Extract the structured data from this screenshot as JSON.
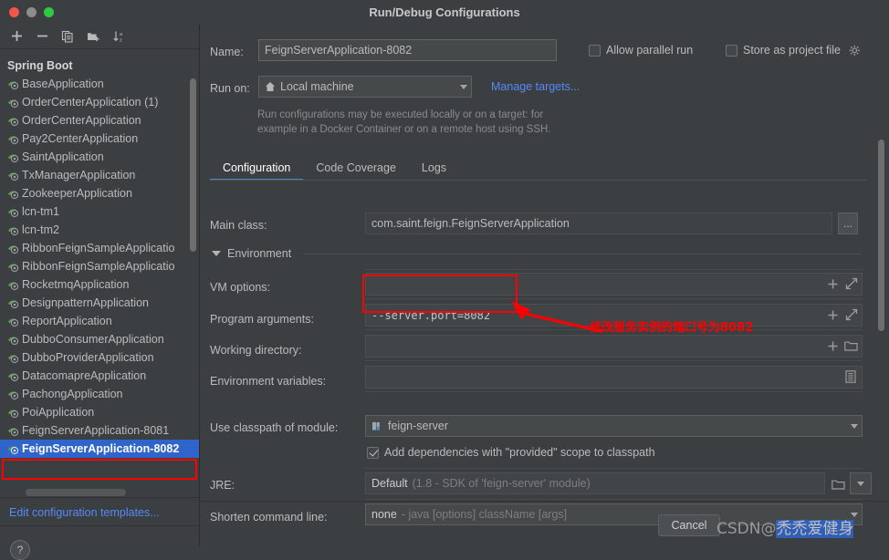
{
  "window": {
    "title": "Run/Debug Configurations",
    "traffic_lights": [
      "close",
      "minimize",
      "zoom"
    ]
  },
  "toolbar": {
    "buttons": [
      {
        "name": "add",
        "icon": "plus-icon"
      },
      {
        "name": "remove",
        "icon": "minus-icon"
      },
      {
        "name": "copy",
        "icon": "copy-icon"
      },
      {
        "name": "save-configuration",
        "icon": "folder-add-icon"
      },
      {
        "name": "sort-alphabetically",
        "icon": "sort-az-icon"
      }
    ]
  },
  "sidebar": {
    "group_header": "Spring Boot",
    "items": [
      {
        "label": "BaseApplication",
        "selected": false
      },
      {
        "label": "OrderCenterApplication (1)",
        "selected": false
      },
      {
        "label": "OrderCenterApplication",
        "selected": false
      },
      {
        "label": "Pay2CenterApplication",
        "selected": false
      },
      {
        "label": "SaintApplication",
        "selected": false
      },
      {
        "label": "TxManagerApplication",
        "selected": false
      },
      {
        "label": "ZookeeperApplication",
        "selected": false
      },
      {
        "label": "lcn-tm1",
        "selected": false
      },
      {
        "label": "lcn-tm2",
        "selected": false
      },
      {
        "label": "RibbonFeignSampleApplicatio",
        "selected": false
      },
      {
        "label": "RibbonFeignSampleApplicatio",
        "selected": false
      },
      {
        "label": "RocketmqApplication",
        "selected": false
      },
      {
        "label": "DesignpatternApplication",
        "selected": false
      },
      {
        "label": "ReportApplication",
        "selected": false
      },
      {
        "label": "DubboConsumerApplication",
        "selected": false
      },
      {
        "label": "DubboProviderApplication",
        "selected": false
      },
      {
        "label": "DatacomapreApplication",
        "selected": false
      },
      {
        "label": "PachongApplication",
        "selected": false
      },
      {
        "label": "PoiApplication",
        "selected": false
      },
      {
        "label": "FeignServerApplication-8081",
        "selected": false
      },
      {
        "label": "FeignServerApplication-8082",
        "selected": true
      }
    ],
    "edit_templates_link": "Edit configuration templates...",
    "help_label": "?"
  },
  "form": {
    "name_label": "Name:",
    "name_value": "FeignServerApplication-8082",
    "allow_parallel_run": {
      "label": "Allow parallel run",
      "checked": false
    },
    "store_as_project_file": {
      "label": "Store as project file",
      "checked": false
    },
    "run_on_label": "Run on:",
    "run_on_value": "Local machine",
    "manage_targets_link": "Manage targets...",
    "hint_line1": "Run configurations may be executed locally or on a target: for",
    "hint_line2": "example in a Docker Container or on a remote host using SSH.",
    "tabs": [
      {
        "label": "Configuration",
        "active": true
      },
      {
        "label": "Code Coverage",
        "active": false
      },
      {
        "label": "Logs",
        "active": false
      }
    ],
    "main_class_label": "Main class:",
    "main_class_value": "com.saint.feign.FeignServerApplication",
    "main_class_browse": "...",
    "environment_section": "Environment",
    "vm_options_label": "VM options:",
    "vm_options_value": "",
    "program_arguments_label": "Program arguments:",
    "program_arguments_value": "--server.port=8082",
    "working_directory_label": "Working directory:",
    "working_directory_value": "",
    "environment_variables_label": "Environment variables:",
    "environment_variables_value": "",
    "use_classpath_label": "Use classpath of module:",
    "use_classpath_value": "feign-server",
    "add_dependencies": {
      "label": "Add dependencies with \"provided\" scope to classpath",
      "checked": true
    },
    "jre_label": "JRE:",
    "jre_value": "Default",
    "jre_value_dim": "(1.8 - SDK of 'feign-server' module)",
    "shorten_label": "Shorten command line:",
    "shorten_value": "none",
    "shorten_value_dim": "- java [options] className [args]"
  },
  "footer": {
    "cancel_label": "Cancel"
  },
  "annotation": {
    "text": "修改服务实例的端口号为8082",
    "color": "#ff0000"
  },
  "watermark": {
    "prefix": "CSDN",
    "at": "@",
    "handle": "禿禿爱健身"
  },
  "colors": {
    "background": "#3c3f41",
    "selection": "#2f65ca",
    "link": "#548af7",
    "tab_accent": "#4a88c7",
    "annotation": "#ff0000",
    "text": "#bbbbbb"
  }
}
